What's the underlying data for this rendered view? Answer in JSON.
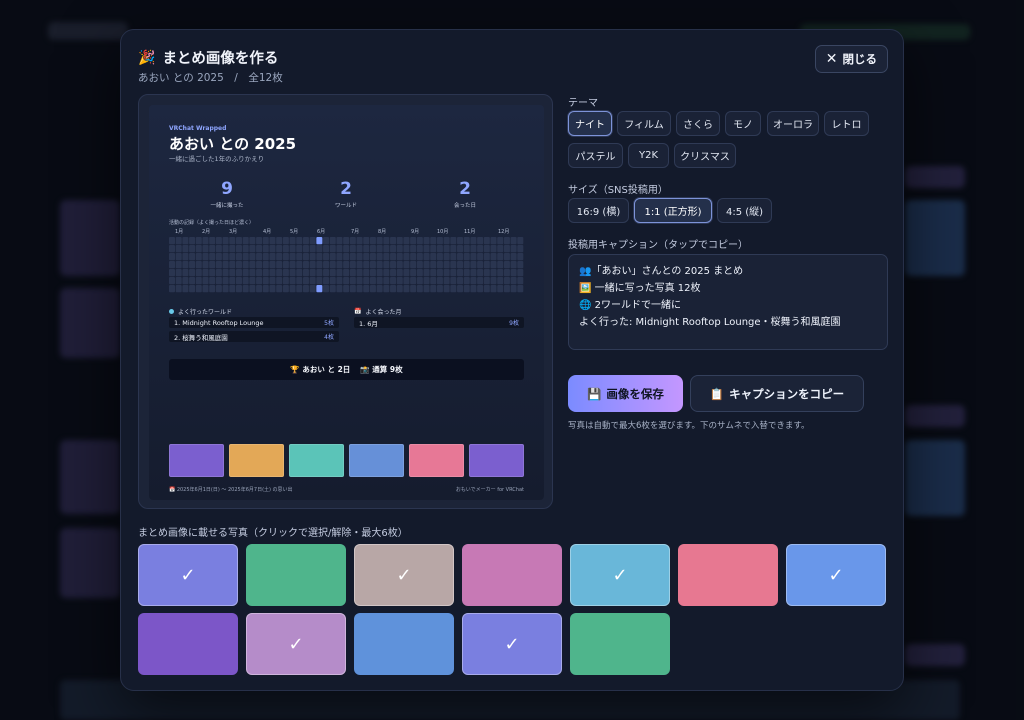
{
  "modal": {
    "icon": "🎉",
    "title": "まとめ画像を作る",
    "subtitle": "あおい との 2025　/　全12枚",
    "close_label": "閉じる"
  },
  "preview": {
    "tag": "VRChat Wrapped",
    "title": "あおい との 2025",
    "subtitle": "一緒に過ごした1年のふりかえり",
    "stats": [
      {
        "value": "9",
        "label": "一緒に撮った"
      },
      {
        "value": "2",
        "label": "ワールド"
      },
      {
        "value": "2",
        "label": "会った日"
      }
    ],
    "heatmap_label": "活動の記録（よく撮った日ほど濃く）",
    "months": [
      "1月",
      "2月",
      "3月",
      "4月",
      "5月",
      "6月",
      "7月",
      "8月",
      "9月",
      "10月",
      "11月",
      "12月"
    ],
    "worlds_heading": "よく行ったワールド",
    "worlds": [
      {
        "name": "1. Midnight Rooftop Lounge",
        "count": "5枚"
      },
      {
        "name": "2. 桜舞う和風庭園",
        "count": "4枚"
      }
    ],
    "months_heading": "よく会った月",
    "top_months": [
      {
        "name": "1. 6月",
        "count": "9枚"
      }
    ],
    "summary_left": "🏆 あおい と 2日",
    "summary_right": "📸 通算 9枚",
    "thumb_colors": [
      "#7b5fcf",
      "#e3a857",
      "#5bc4b8",
      "#6690d8",
      "#e77896",
      "#7b5fcf"
    ],
    "footer_left": "📅 2025年6月1日(日) 〜 2025年6月7日(土) の思い出",
    "footer_right": "おもいでメーカー for VRChat"
  },
  "theme": {
    "label": "テーマ",
    "options": [
      "ナイト",
      "フィルム",
      "さくら",
      "モノ",
      "オーロラ",
      "レトロ",
      "パステル",
      "Y2K",
      "クリスマス"
    ],
    "selected": "ナイト"
  },
  "size": {
    "label": "サイズ（SNS投稿用）",
    "options": [
      "16:9 (横)",
      "1:1 (正方形)",
      "4:5 (縦)"
    ],
    "selected": "1:1 (正方形)"
  },
  "caption": {
    "label": "投稿用キャプション（タップでコピー）",
    "text": "👥「あおい」さんとの 2025 まとめ\n🖼️ 一緒に写った写真 12枚\n🌐 2ワールドで一緒に\nよく行った: Midnight Rooftop Lounge・桜舞う和風庭園"
  },
  "actions": {
    "save_icon": "💾",
    "save_label": "画像を保存",
    "copy_icon": "📋",
    "copy_label": "キャプションをコピー",
    "hint": "写真は自動で最大6枚を選びます。下のサムネで入替できます。"
  },
  "picker": {
    "label": "まとめ画像に載せる写真（クリックで選択/解除・最大6枚）",
    "check": "✓",
    "photos": [
      {
        "color": "#7a7fe0",
        "selected": true
      },
      {
        "color": "#4fb58c",
        "selected": false
      },
      {
        "color": "#b8a7a6",
        "selected": true
      },
      {
        "color": "#c779b5",
        "selected": false
      },
      {
        "color": "#69b7d9",
        "selected": true
      },
      {
        "color": "#e77891",
        "selected": false
      },
      {
        "color": "#6997ea",
        "selected": true
      },
      {
        "color": "#7c56c8",
        "selected": false
      },
      {
        "color": "#b58cc9",
        "selected": true
      },
      {
        "color": "#5f92db",
        "selected": false
      },
      {
        "color": "#7a7fe0",
        "selected": true
      },
      {
        "color": "#4fb58c",
        "selected": false
      }
    ]
  }
}
